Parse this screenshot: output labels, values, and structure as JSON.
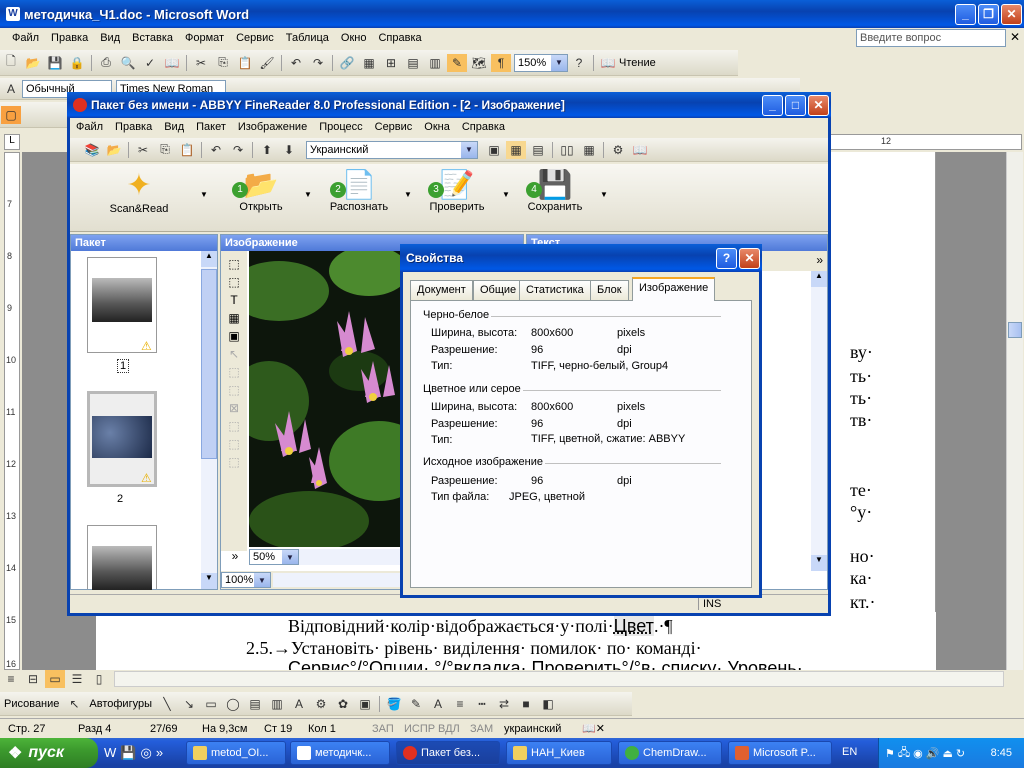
{
  "word": {
    "title": "методичка_Ч1.doc - Microsoft Word",
    "menu": [
      "Файл",
      "Правка",
      "Вид",
      "Вставка",
      "Формат",
      "Сервис",
      "Таблица",
      "Окно",
      "Справка"
    ],
    "help_placeholder": "Введите вопрос",
    "zoom": "150%",
    "reading_label": "Чтение",
    "style_value": "Обычный",
    "font_value": "Times New Roman",
    "doc_lines": {
      "right1": "ву·",
      "right2": "ть·",
      "right3": "ть·",
      "right4": "тв·",
      "right5": "те·",
      "right6": "°у·",
      "right7": "но·",
      "right8": "ка·",
      "right9": "кт.·",
      "line1": "Відповідний·колір·відображається·у·полі·",
      "line1_field": "Цвет",
      "line1_end": ".·¶",
      "line2_num": "2.5.→",
      "line2": "Установіть·  рівень·  виділення·  помилок·  по·  команді·",
      "line3": "Сервис°/°Опции·  °/°вкладка·  Проверить°/°в·  списку·  Уровень·"
    },
    "ruler_num": "12",
    "vertical_ruler": [
      "7",
      "8",
      "9",
      "10",
      "11",
      "12",
      "13",
      "14",
      "15",
      "16"
    ],
    "drawing_label": "Рисование",
    "autoshapes_label": "Автофигуры",
    "status": {
      "page": "Стр. 27",
      "section": "Разд 4",
      "pages": "27/69",
      "at": "На 9,3см",
      "line": "Ст 19",
      "col": "Кол 1",
      "rec": "ЗАП",
      "trk": "ИСПР",
      "ext": "ВДЛ",
      "ovr": "ЗАМ",
      "lang": "украинский"
    }
  },
  "finereader": {
    "title": "Пакет без имени - ABBYY FineReader 8.0 Professional Edition - [2 - Изображение]",
    "menu": [
      "Файл",
      "Правка",
      "Вид",
      "Пакет",
      "Изображение",
      "Процесс",
      "Сервис",
      "Окна",
      "Справка"
    ],
    "language": "Украинский",
    "big_buttons": [
      {
        "label": "Scan&Read",
        "num": ""
      },
      {
        "label": "Открыть",
        "num": "1"
      },
      {
        "label": "Распознать",
        "num": "2"
      },
      {
        "label": "Проверить",
        "num": "3"
      },
      {
        "label": "Сохранить",
        "num": "4"
      }
    ],
    "panel_batch": "Пакет",
    "panel_image": "Изображение",
    "panel_text": "Текст",
    "pages": [
      {
        "num": "1"
      },
      {
        "num": "2"
      }
    ],
    "image_zoom": "50%",
    "zoom2": "100%",
    "status_ins": "INS"
  },
  "dialog": {
    "title": "Свойства",
    "tabs": [
      "Документ",
      "Общие",
      "Статистика",
      "Блок",
      "Изображение"
    ],
    "groups": [
      {
        "title": "Черно-белое",
        "rows": [
          {
            "label": "Ширина, высота:",
            "value": "800x600",
            "unit": "pixels"
          },
          {
            "label": "Разрешение:",
            "value": "96",
            "unit": "dpi"
          },
          {
            "label": "Тип:",
            "value": "TIFF, черно-белый, Group4",
            "unit": ""
          }
        ]
      },
      {
        "title": "Цветное или серое",
        "rows": [
          {
            "label": "Ширина, высота:",
            "value": "800x600",
            "unit": "pixels"
          },
          {
            "label": "Разрешение:",
            "value": "96",
            "unit": "dpi"
          },
          {
            "label": "Тип:",
            "value": "TIFF, цветной, сжатие: ABBYY",
            "unit": ""
          }
        ]
      },
      {
        "title": "Исходное изображение",
        "rows": [
          {
            "label": "Разрешение:",
            "value": "96",
            "unit": "dpi"
          },
          {
            "label": "Тип файла:",
            "value": "JPEG, цветной",
            "unit": ""
          }
        ]
      }
    ]
  },
  "taskbar": {
    "start": "пуск",
    "buttons": [
      "metod_OI...",
      "методичк...",
      "Пакет без...",
      "НАН_Киев",
      "ChemDraw...",
      "Microsoft P..."
    ],
    "lang": "EN",
    "clock": "8:45",
    "colors": {
      "start": "#3c9a2e",
      "bar": "#245edb"
    }
  }
}
